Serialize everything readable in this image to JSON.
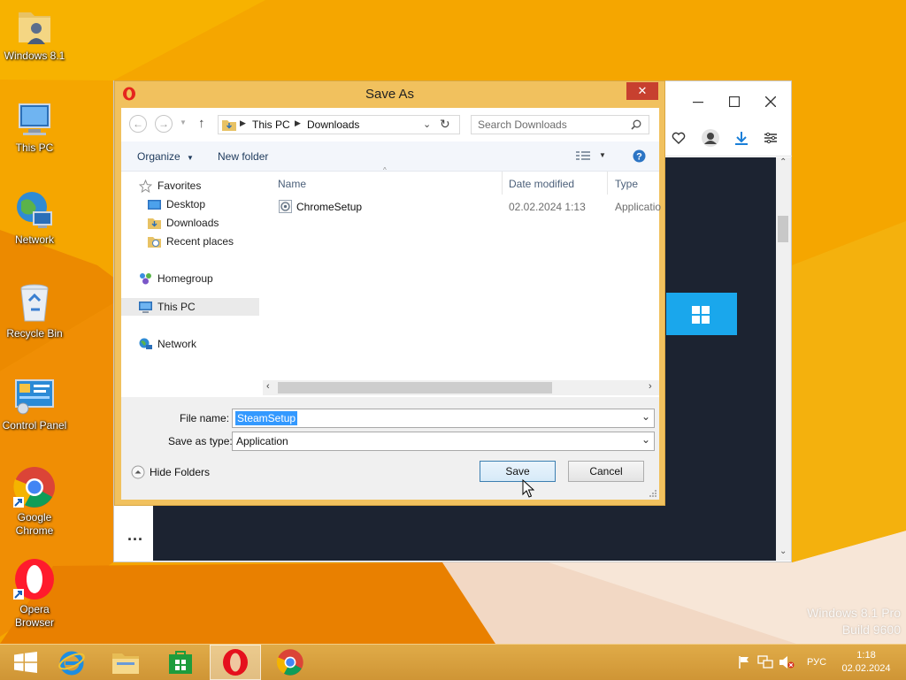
{
  "desktop": {
    "icons": [
      {
        "label": "Windows 8.1",
        "icon": "user-folder-icon"
      },
      {
        "label": "This PC",
        "icon": "computer-icon"
      },
      {
        "label": "Network",
        "icon": "network-globe-icon"
      },
      {
        "label": "Recycle Bin",
        "icon": "recycle-bin-icon"
      },
      {
        "label": "Control Panel",
        "icon": "control-panel-icon"
      },
      {
        "label": "Google Chrome",
        "icon": "chrome-icon"
      },
      {
        "label": "Opera Browser",
        "icon": "opera-icon"
      }
    ],
    "watermark": {
      "line1": "Windows 8.1 Pro",
      "line2": "Build 9600"
    }
  },
  "dialog": {
    "title": "Save As",
    "close_label": "✕",
    "breadcrumb": [
      "This PC",
      "Downloads"
    ],
    "search_placeholder": "Search Downloads",
    "organize_label": "Organize",
    "new_folder_label": "New folder",
    "nav": {
      "favorites": "Favorites",
      "desktop": "Desktop",
      "downloads": "Downloads",
      "recent": "Recent places",
      "homegroup": "Homegroup",
      "this_pc": "This PC",
      "network": "Network"
    },
    "columns": {
      "name": "Name",
      "date": "Date modified",
      "type": "Type"
    },
    "files": [
      {
        "name": "ChromeSetup",
        "date": "02.02.2024 1:13",
        "type": "Applicatio"
      }
    ],
    "file_name_label": "File name:",
    "file_name_value": "SteamSetup",
    "save_type_label": "Save as type:",
    "save_type_value": "Application",
    "hide_folders_label": "Hide Folders",
    "save_label": "Save",
    "cancel_label": "Cancel"
  },
  "browser": {
    "more_label": "..."
  },
  "taskbar": {
    "language": "РУС",
    "time": "1:18",
    "date": "02.02.2024"
  },
  "colors": {
    "wallpaper": "#f5a800",
    "dialog_frame": "#f1c15e",
    "close_button": "#c7402f",
    "accent_blue": "#1aa7ec",
    "selection": "#3399ff"
  }
}
